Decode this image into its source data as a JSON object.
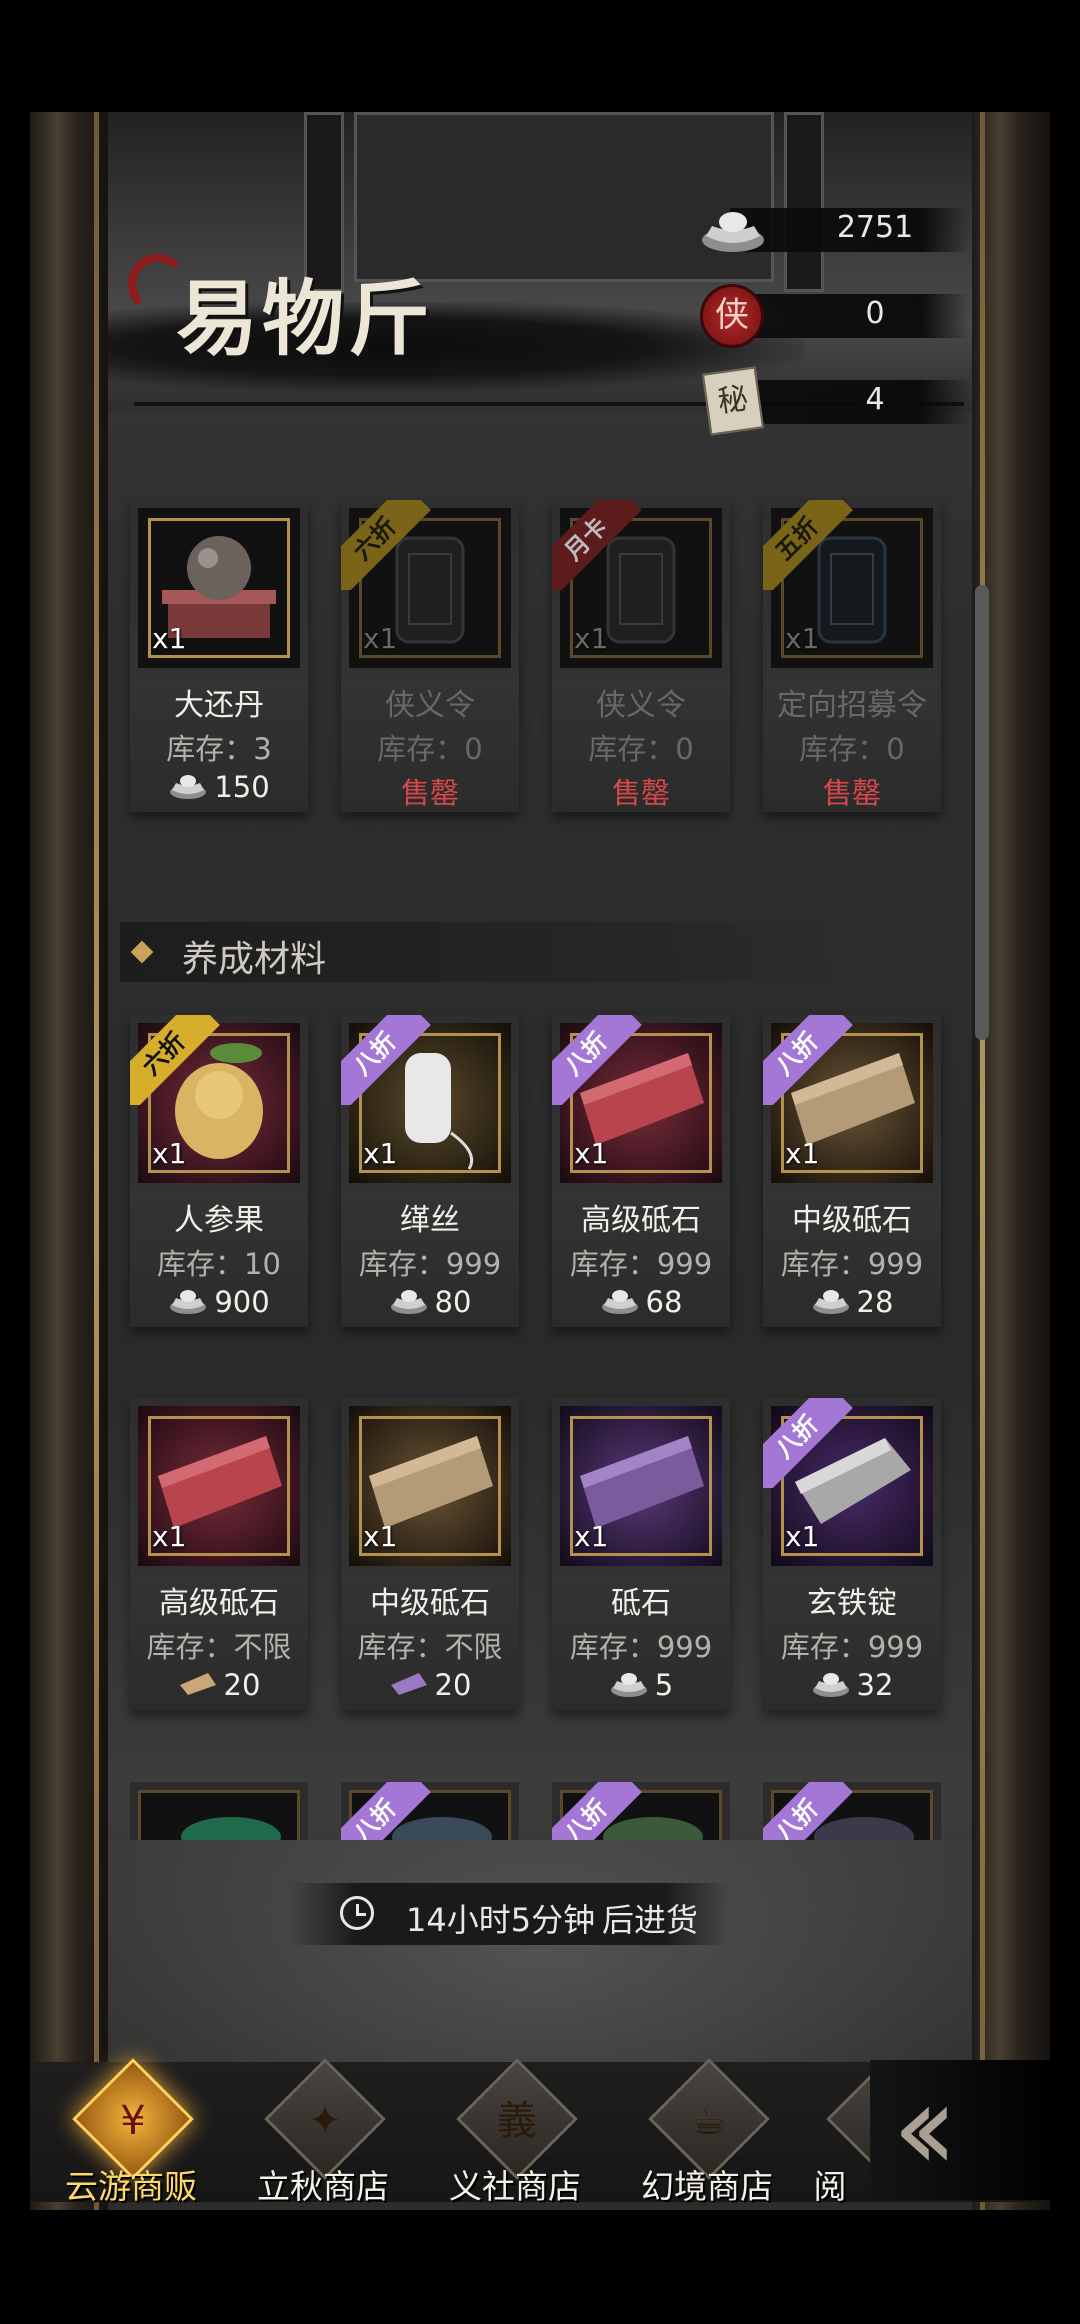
{
  "header": {
    "title": "易物斤"
  },
  "currencies": [
    {
      "icon": "silver-ingot-icon",
      "value": "2751"
    },
    {
      "icon": "xia-seal-icon",
      "glyph": "侠",
      "value": "0"
    },
    {
      "icon": "secret-book-icon",
      "glyph": "秘",
      "value": "4"
    }
  ],
  "featured": [
    {
      "name": "大还丹",
      "qty": "x1",
      "stock": "库存：3",
      "price": "150",
      "currency": "silver",
      "tag": "",
      "soldout": false
    },
    {
      "name": "侠义令",
      "qty": "x1",
      "stock": "库存：0",
      "price": "售罄",
      "tag": "六折",
      "tag_color": "gold",
      "soldout": true
    },
    {
      "name": "侠义令",
      "qty": "x1",
      "stock": "库存：0",
      "price": "售罄",
      "tag": "月卡",
      "tag_color": "red",
      "soldout": true
    },
    {
      "name": "定向招募令",
      "qty": "x1",
      "stock": "库存：0",
      "price": "售罄",
      "tag": "五折",
      "tag_color": "gold",
      "soldout": true
    }
  ],
  "section": {
    "label": "养成材料"
  },
  "materials_row1": [
    {
      "name": "人参果",
      "qty": "x1",
      "stock": "库存：10",
      "price": "900",
      "currency": "silver",
      "tag": "六折",
      "tag_color": "gold"
    },
    {
      "name": "缂丝",
      "qty": "x1",
      "stock": "库存：999",
      "price": "80",
      "currency": "silver",
      "tag": "八折",
      "tag_color": "purple"
    },
    {
      "name": "高级砥石",
      "qty": "x1",
      "stock": "库存：999",
      "price": "68",
      "currency": "silver",
      "tag": "八折",
      "tag_color": "purple"
    },
    {
      "name": "中级砥石",
      "qty": "x1",
      "stock": "库存：999",
      "price": "28",
      "currency": "silver",
      "tag": "八折",
      "tag_color": "purple"
    }
  ],
  "materials_row2": [
    {
      "name": "高级砥石",
      "qty": "x1",
      "stock": "库存：不限",
      "price": "20",
      "currency": "gold-whetstone",
      "tag": ""
    },
    {
      "name": "中级砥石",
      "qty": "x1",
      "stock": "库存：不限",
      "price": "20",
      "currency": "purple-whetstone",
      "tag": ""
    },
    {
      "name": "砥石",
      "qty": "x1",
      "stock": "库存：999",
      "price": "5",
      "currency": "silver",
      "tag": ""
    },
    {
      "name": "玄铁锭",
      "qty": "x1",
      "stock": "库存：999",
      "price": "32",
      "currency": "silver",
      "tag": "八折",
      "tag_color": "purple"
    }
  ],
  "materials_row3_tags": [
    "",
    "八折",
    "八折",
    "八折"
  ],
  "restock": {
    "time": "14小时5分钟",
    "suffix": "后进货"
  },
  "tabs": [
    {
      "label": "云游商贩",
      "icon": "merchant-coin-icon",
      "active": true
    },
    {
      "label": "立秋商店",
      "icon": "treasure-chest-icon",
      "active": false
    },
    {
      "label": "义社商店",
      "icon": "scroll-seal-icon",
      "active": false
    },
    {
      "label": "幻境商店",
      "icon": "teapot-icon",
      "active": false
    },
    {
      "label": "阅",
      "icon": "book-shop-icon",
      "active": false
    }
  ],
  "colors": {
    "sold_out": "#d8474a",
    "discount_gold": "#d7ad2c",
    "discount_purple": "#a477d6",
    "monthly_red": "#a52d2d",
    "active_tab": "#ffd86a"
  }
}
